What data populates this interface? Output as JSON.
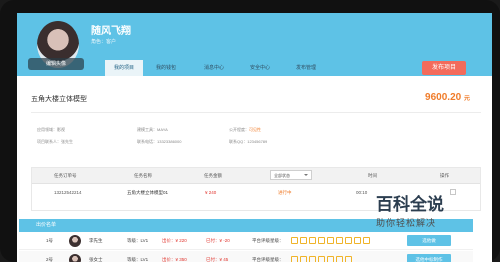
{
  "header": {
    "avatar_caption": "编辑头像",
    "user_name": "随风飞翔",
    "user_role": "角色：客户",
    "tabs": [
      "我的项目",
      "我的钱包",
      "消息中心",
      "安全中心",
      "发布管理"
    ],
    "publish_button": "发布项目"
  },
  "project": {
    "title": "五角大楼立体模型",
    "price": "9600.20",
    "price_unit": "元",
    "info": {
      "industry": "应用领域：影视",
      "software": "建模工具：MAYA",
      "status_label": "公开程度：",
      "status_value": "可见性",
      "manager": "项目联系人：张先生",
      "phone": "联系电话：13323386000",
      "qq": "联系QQ：123456789"
    }
  },
  "table": {
    "headers": [
      "任务订单号",
      "任务名称",
      "任务金额",
      "",
      "时间",
      "操作"
    ],
    "filter_label": "全部状态",
    "row": {
      "order_id": "13212542214",
      "name": "五角大楼立体模型01",
      "amount": "¥ 240",
      "status": "进行中",
      "time": "00:10"
    }
  },
  "bidders": {
    "title": "出价名单",
    "rows": [
      {
        "rank": "1号",
        "name": "李先生",
        "level": "等级：LV1",
        "price": "出价：¥ 220",
        "deposit": "已付：¥ -20",
        "evaluation": "平台评级星级：",
        "action": "选他做"
      },
      {
        "rank": "2号",
        "name": "张女士",
        "level": "等级：LV1",
        "price": "出价：¥ 350",
        "deposit": "已付：¥ 45",
        "evaluation": "平台评级星级：",
        "action": "选他中标制作"
      }
    ]
  },
  "watermark": {
    "main": "百科全说",
    "sub": "助你轻松解决"
  }
}
